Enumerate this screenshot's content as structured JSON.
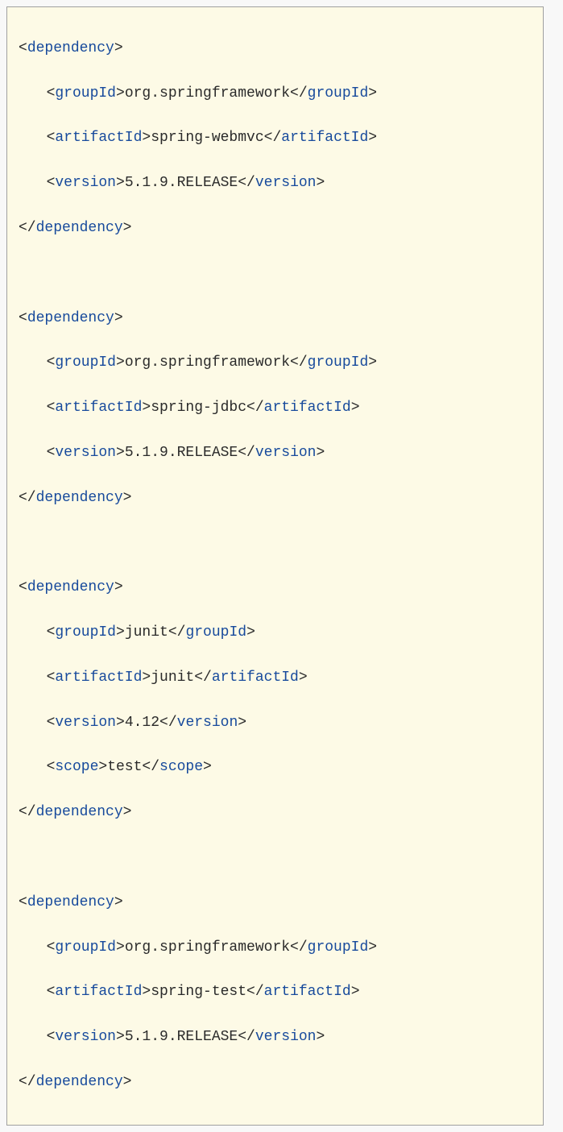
{
  "xml": {
    "tags": {
      "dependency": "dependency",
      "groupId": "groupId",
      "artifactId": "artifactId",
      "version": "version",
      "scope": "scope"
    },
    "dependencies": [
      {
        "groupId": "org.springframework",
        "artifactId": "spring-webmvc",
        "version": "5.1.9.RELEASE"
      },
      {
        "groupId": "org.springframework",
        "artifactId": "spring-jdbc",
        "version": "5.1.9.RELEASE"
      },
      {
        "groupId": "junit",
        "artifactId": "junit",
        "version": "4.12",
        "scope": "test"
      },
      {
        "groupId": "org.springframework",
        "artifactId": "spring-test",
        "version": "5.1.9.RELEASE"
      }
    ]
  }
}
